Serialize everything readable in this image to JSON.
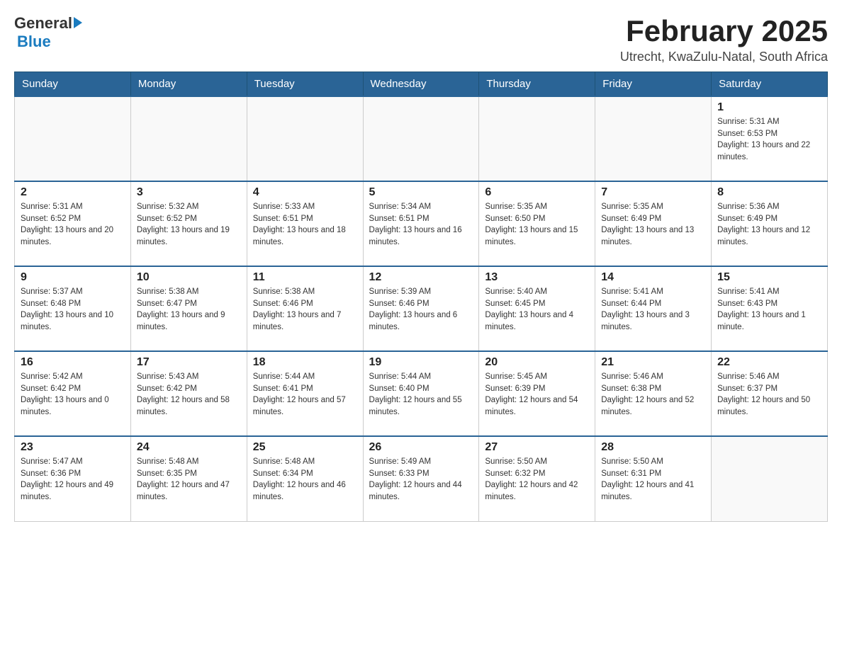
{
  "header": {
    "logo_general": "General",
    "logo_blue": "Blue",
    "month_title": "February 2025",
    "location": "Utrecht, KwaZulu-Natal, South Africa"
  },
  "days_of_week": [
    "Sunday",
    "Monday",
    "Tuesday",
    "Wednesday",
    "Thursday",
    "Friday",
    "Saturday"
  ],
  "weeks": [
    {
      "days": [
        {
          "number": "",
          "info": ""
        },
        {
          "number": "",
          "info": ""
        },
        {
          "number": "",
          "info": ""
        },
        {
          "number": "",
          "info": ""
        },
        {
          "number": "",
          "info": ""
        },
        {
          "number": "",
          "info": ""
        },
        {
          "number": "1",
          "info": "Sunrise: 5:31 AM\nSunset: 6:53 PM\nDaylight: 13 hours and 22 minutes."
        }
      ]
    },
    {
      "days": [
        {
          "number": "2",
          "info": "Sunrise: 5:31 AM\nSunset: 6:52 PM\nDaylight: 13 hours and 20 minutes."
        },
        {
          "number": "3",
          "info": "Sunrise: 5:32 AM\nSunset: 6:52 PM\nDaylight: 13 hours and 19 minutes."
        },
        {
          "number": "4",
          "info": "Sunrise: 5:33 AM\nSunset: 6:51 PM\nDaylight: 13 hours and 18 minutes."
        },
        {
          "number": "5",
          "info": "Sunrise: 5:34 AM\nSunset: 6:51 PM\nDaylight: 13 hours and 16 minutes."
        },
        {
          "number": "6",
          "info": "Sunrise: 5:35 AM\nSunset: 6:50 PM\nDaylight: 13 hours and 15 minutes."
        },
        {
          "number": "7",
          "info": "Sunrise: 5:35 AM\nSunset: 6:49 PM\nDaylight: 13 hours and 13 minutes."
        },
        {
          "number": "8",
          "info": "Sunrise: 5:36 AM\nSunset: 6:49 PM\nDaylight: 13 hours and 12 minutes."
        }
      ]
    },
    {
      "days": [
        {
          "number": "9",
          "info": "Sunrise: 5:37 AM\nSunset: 6:48 PM\nDaylight: 13 hours and 10 minutes."
        },
        {
          "number": "10",
          "info": "Sunrise: 5:38 AM\nSunset: 6:47 PM\nDaylight: 13 hours and 9 minutes."
        },
        {
          "number": "11",
          "info": "Sunrise: 5:38 AM\nSunset: 6:46 PM\nDaylight: 13 hours and 7 minutes."
        },
        {
          "number": "12",
          "info": "Sunrise: 5:39 AM\nSunset: 6:46 PM\nDaylight: 13 hours and 6 minutes."
        },
        {
          "number": "13",
          "info": "Sunrise: 5:40 AM\nSunset: 6:45 PM\nDaylight: 13 hours and 4 minutes."
        },
        {
          "number": "14",
          "info": "Sunrise: 5:41 AM\nSunset: 6:44 PM\nDaylight: 13 hours and 3 minutes."
        },
        {
          "number": "15",
          "info": "Sunrise: 5:41 AM\nSunset: 6:43 PM\nDaylight: 13 hours and 1 minute."
        }
      ]
    },
    {
      "days": [
        {
          "number": "16",
          "info": "Sunrise: 5:42 AM\nSunset: 6:42 PM\nDaylight: 13 hours and 0 minutes."
        },
        {
          "number": "17",
          "info": "Sunrise: 5:43 AM\nSunset: 6:42 PM\nDaylight: 12 hours and 58 minutes."
        },
        {
          "number": "18",
          "info": "Sunrise: 5:44 AM\nSunset: 6:41 PM\nDaylight: 12 hours and 57 minutes."
        },
        {
          "number": "19",
          "info": "Sunrise: 5:44 AM\nSunset: 6:40 PM\nDaylight: 12 hours and 55 minutes."
        },
        {
          "number": "20",
          "info": "Sunrise: 5:45 AM\nSunset: 6:39 PM\nDaylight: 12 hours and 54 minutes."
        },
        {
          "number": "21",
          "info": "Sunrise: 5:46 AM\nSunset: 6:38 PM\nDaylight: 12 hours and 52 minutes."
        },
        {
          "number": "22",
          "info": "Sunrise: 5:46 AM\nSunset: 6:37 PM\nDaylight: 12 hours and 50 minutes."
        }
      ]
    },
    {
      "days": [
        {
          "number": "23",
          "info": "Sunrise: 5:47 AM\nSunset: 6:36 PM\nDaylight: 12 hours and 49 minutes."
        },
        {
          "number": "24",
          "info": "Sunrise: 5:48 AM\nSunset: 6:35 PM\nDaylight: 12 hours and 47 minutes."
        },
        {
          "number": "25",
          "info": "Sunrise: 5:48 AM\nSunset: 6:34 PM\nDaylight: 12 hours and 46 minutes."
        },
        {
          "number": "26",
          "info": "Sunrise: 5:49 AM\nSunset: 6:33 PM\nDaylight: 12 hours and 44 minutes."
        },
        {
          "number": "27",
          "info": "Sunrise: 5:50 AM\nSunset: 6:32 PM\nDaylight: 12 hours and 42 minutes."
        },
        {
          "number": "28",
          "info": "Sunrise: 5:50 AM\nSunset: 6:31 PM\nDaylight: 12 hours and 41 minutes."
        },
        {
          "number": "",
          "info": ""
        }
      ]
    }
  ]
}
